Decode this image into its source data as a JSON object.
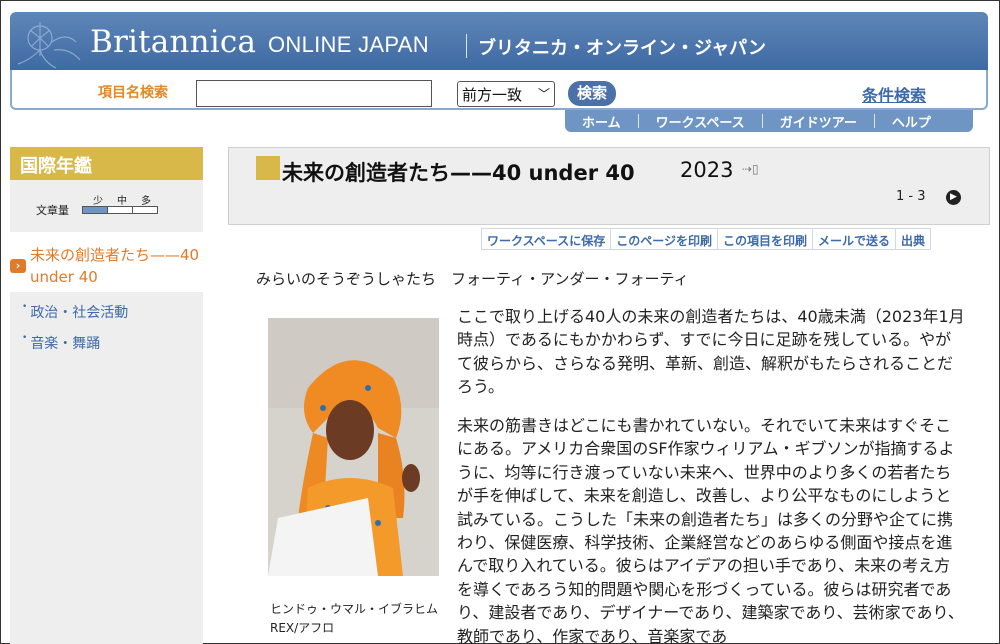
{
  "header": {
    "brand": "Britannica",
    "brand_sub": "ONLINE JAPAN",
    "brand_jp": "ブリタニカ・オンライン・ジャパン"
  },
  "search": {
    "label": "項目名検索",
    "input_value": "",
    "select_value": "前方一致",
    "button_label": "検索",
    "advanced_label": "条件検索"
  },
  "nav": {
    "items": [
      "ホーム",
      "ワークスペース",
      "ガイドツアー",
      "ヘルプ"
    ]
  },
  "sidebar": {
    "heading": "国際年鑑",
    "length_label": "文章量",
    "length_marks": [
      "少",
      "中",
      "多"
    ],
    "length_level": "少",
    "current_item": "未来の創造者たち——40 under 40",
    "items": [
      "政治・社会活動",
      "音楽・舞踊"
    ]
  },
  "article": {
    "title": "未来の創造者たち——40 under 40",
    "year": "2023",
    "pages": "1 - 3",
    "tools": [
      "ワークスペースに保存",
      "このページを印刷",
      "この項目を印刷",
      "メールで送る",
      "出典"
    ],
    "reading": "みらいのそうぞうしゃたち　フォーティ・アンダー・フォーティ",
    "caption_line1": "ヒンドゥ・ウマル・イブラヒム",
    "caption_line2": "REX/アフロ",
    "paragraph1": "ここで取り上げる40人の未来の創造者たちは、40歳未満（2023年1月時点）であるにもかかわらず、すでに今日に足跡を残している。やがて彼らから、さらなる発明、革新、創造、解釈がもたらされることだろう。",
    "paragraph2": "未来の筋書きはどこにも書かれていない。それでいて未来はすぐそこにある。アメリカ合衆国のSF作家ウィリアム・ギブソンが指摘するように、均等に行き渡っていない未来へ、世界中のより多くの若者たちが手を伸ばして、未来を創造し、改善し、より公平なものにしようと試みている。こうした「未来の創造者たち」は多くの分野や企てに携わり、保健医療、科学技術、企業経営などのあらゆる側面や接点を進んで取り入れている。彼らはアイデアの担い手であり、未来の考え方を導くであろう知的問題や関心を形づくっている。彼らは研究者であり、建設者であり、デザイナーであり、建築家であり、芸術家であり、教師であり、作家であり、音楽家であ"
  },
  "colors": {
    "banner": "#4a72a8",
    "accent_gold": "#d9b84a",
    "accent_orange": "#e07b2a",
    "link_blue": "#3d6aa8"
  }
}
